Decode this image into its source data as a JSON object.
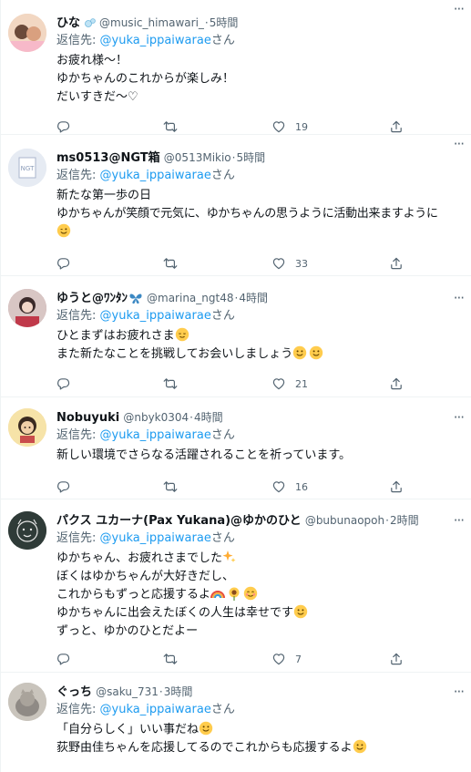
{
  "reply_prefix": "返信先:",
  "reply_suffix": "さん",
  "tweets": [
    {
      "name": "ひな",
      "handle": "@music_himawari_",
      "time": "5時間",
      "reply_to": "@yuka_ippaiwarae",
      "lines": [
        "お疲れ様〜！",
        "ゆかちゃんのこれからが楽しみ！",
        "だいすきだ〜♡"
      ],
      "likes": "19",
      "avatar_color": "#e8c9b0"
    },
    {
      "name": "ms0513@NGT箱",
      "handle": "@0513Mikio",
      "time": "5時間",
      "reply_to": "@yuka_ippaiwarae",
      "lines": [
        "新たな第一歩の日",
        "ゆかちゃんが笑顔で元気に、ゆかちゃんの思うように活動出来ますように",
        ""
      ],
      "likes": "33",
      "avatar_color": "#dde4ee"
    },
    {
      "name": "ゆうと@ﾜﾝﾀﾝ",
      "handle": "@marina_ngt48",
      "time": "4時間",
      "reply_to": "@yuka_ippaiwarae",
      "lines": [
        "ひとまずはお疲れさま",
        "また新たなことを挑戦してお会いしましょう"
      ],
      "likes": "21",
      "avatar_color": "#b9868f"
    },
    {
      "name": "Nobuyuki",
      "handle": "@nbyk0304",
      "time": "4時間",
      "reply_to": "@yuka_ippaiwarae",
      "lines": [
        "新しい環境でさらなる活躍されることを祈っています。"
      ],
      "likes": "16",
      "avatar_color": "#f4d18a"
    },
    {
      "name": "パクス ユカーナ(Pax Yukana)@ゆかのひと",
      "handle": "@bubunaopoh",
      "time": "2時間",
      "reply_to": "@yuka_ippaiwarae",
      "lines": [
        "ゆかちゃん、お疲れさまでした",
        "ぼくはゆかちゃんが大好きだし、",
        "これからもずっと応援するよ",
        "ゆかちゃんに出会えたぼくの人生は幸せです",
        "ずっと、ゆかのひとだよー"
      ],
      "likes": "7",
      "avatar_color": "#2d3a36"
    },
    {
      "name": "ぐっち",
      "handle": "@saku_731",
      "time": "3時間",
      "reply_to": "@yuka_ippaiwarae",
      "lines": [
        "「自分らしく」いい事だね",
        "荻野由佳ちゃんを応援してるのでこれからも応援するよ"
      ],
      "avatar_color": "#b7b1a8"
    }
  ]
}
